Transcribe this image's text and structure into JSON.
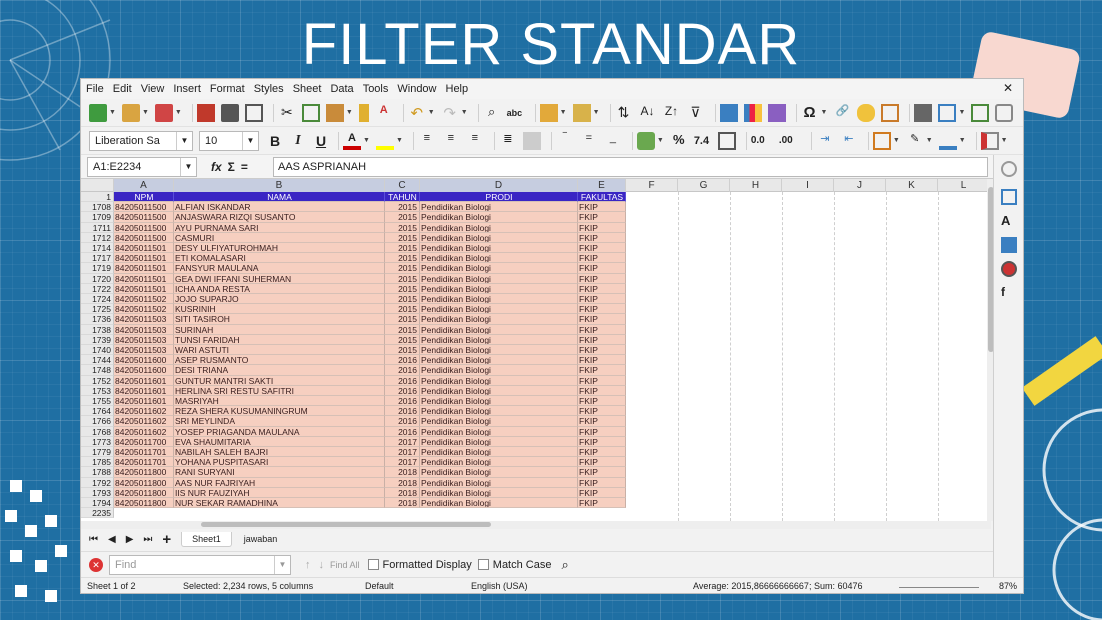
{
  "slide": {
    "title": "FILTER STANDAR"
  },
  "menu": [
    "File",
    "Edit",
    "View",
    "Insert",
    "Format",
    "Styles",
    "Sheet",
    "Data",
    "Tools",
    "Window",
    "Help"
  ],
  "toolbar": {
    "font_name": "Liberation Sa",
    "font_size": "10",
    "bold": "B",
    "italic": "I",
    "underline": "U",
    "percent": "%",
    "number_format": "7.4",
    "decimals_add": "0.0",
    "decimals_remove": ".00",
    "special_char": "Ω"
  },
  "formula_bar": {
    "name_box": "A1:E2234",
    "function_wizard": "fx",
    "sum": "Σ",
    "equals": "=",
    "content": "AAS ASPRIANAH"
  },
  "columns": [
    "A",
    "B",
    "C",
    "D",
    "E",
    "F",
    "G",
    "H",
    "I",
    "J",
    "K",
    "L"
  ],
  "header_row": {
    "row": "1",
    "cells": [
      "NPM",
      "NAMA",
      "TAHUN",
      "PRODI",
      "FAKULTAS"
    ]
  },
  "rows": [
    {
      "r": "1708",
      "npm": "84205011500",
      "nama": "ALFIAN ISKANDAR",
      "tahun": "2015",
      "prodi": "Pendidikan Biologi",
      "fak": "FKIP"
    },
    {
      "r": "1709",
      "npm": "84205011500",
      "nama": "ANJASWARA RIZQI SUSANTO",
      "tahun": "2015",
      "prodi": "Pendidikan Biologi",
      "fak": "FKIP"
    },
    {
      "r": "1711",
      "npm": "84205011500",
      "nama": "AYU PURNAMA SARI",
      "tahun": "2015",
      "prodi": "Pendidikan Biologi",
      "fak": "FKIP"
    },
    {
      "r": "1712",
      "npm": "84205011500",
      "nama": "CASMURI",
      "tahun": "2015",
      "prodi": "Pendidikan Biologi",
      "fak": "FKIP"
    },
    {
      "r": "1714",
      "npm": "84205011501",
      "nama": "DESY ULFIYATUROHMAH",
      "tahun": "2015",
      "prodi": "Pendidikan Biologi",
      "fak": "FKIP"
    },
    {
      "r": "1717",
      "npm": "84205011501",
      "nama": "ETI KOMALASARI",
      "tahun": "2015",
      "prodi": "Pendidikan Biologi",
      "fak": "FKIP"
    },
    {
      "r": "1719",
      "npm": "84205011501",
      "nama": "FANSYUR MAULANA",
      "tahun": "2015",
      "prodi": "Pendidikan Biologi",
      "fak": "FKIP"
    },
    {
      "r": "1720",
      "npm": "84205011501",
      "nama": "GEA DWI IFFANI SUHERMAN",
      "tahun": "2015",
      "prodi": "Pendidikan Biologi",
      "fak": "FKIP"
    },
    {
      "r": "1722",
      "npm": "84205011501",
      "nama": "ICHA ANDA RESTA",
      "tahun": "2015",
      "prodi": "Pendidikan Biologi",
      "fak": "FKIP"
    },
    {
      "r": "1724",
      "npm": "84205011502",
      "nama": "JOJO SUPARJO",
      "tahun": "2015",
      "prodi": "Pendidikan Biologi",
      "fak": "FKIP"
    },
    {
      "r": "1725",
      "npm": "84205011502",
      "nama": "KUSRINIH",
      "tahun": "2015",
      "prodi": "Pendidikan Biologi",
      "fak": "FKIP"
    },
    {
      "r": "1736",
      "npm": "84205011503",
      "nama": "SITI TASIROH",
      "tahun": "2015",
      "prodi": "Pendidikan Biologi",
      "fak": "FKIP"
    },
    {
      "r": "1738",
      "npm": "84205011503",
      "nama": "SURINAH",
      "tahun": "2015",
      "prodi": "Pendidikan Biologi",
      "fak": "FKIP"
    },
    {
      "r": "1739",
      "npm": "84205011503",
      "nama": "TUNSI FARIDAH",
      "tahun": "2015",
      "prodi": "Pendidikan Biologi",
      "fak": "FKIP"
    },
    {
      "r": "1740",
      "npm": "84205011503",
      "nama": "WARI ASTUTI",
      "tahun": "2015",
      "prodi": "Pendidikan Biologi",
      "fak": "FKIP"
    },
    {
      "r": "1744",
      "npm": "84205011600",
      "nama": "ASEP RUSMANTO",
      "tahun": "2016",
      "prodi": "Pendidikan Biologi",
      "fak": "FKIP"
    },
    {
      "r": "1748",
      "npm": "84205011600",
      "nama": "DESI TRIANA",
      "tahun": "2016",
      "prodi": "Pendidikan Biologi",
      "fak": "FKIP"
    },
    {
      "r": "1752",
      "npm": "84205011601",
      "nama": "GUNTUR MANTRI SAKTI",
      "tahun": "2016",
      "prodi": "Pendidikan Biologi",
      "fak": "FKIP"
    },
    {
      "r": "1753",
      "npm": "84205011601",
      "nama": "HERLINA SRI RESTU SAFITRI",
      "tahun": "2016",
      "prodi": "Pendidikan Biologi",
      "fak": "FKIP"
    },
    {
      "r": "1755",
      "npm": "84205011601",
      "nama": "MASRIYAH",
      "tahun": "2016",
      "prodi": "Pendidikan Biologi",
      "fak": "FKIP"
    },
    {
      "r": "1764",
      "npm": "84205011602",
      "nama": "REZA SHERA KUSUMANINGRUM",
      "tahun": "2016",
      "prodi": "Pendidikan Biologi",
      "fak": "FKIP"
    },
    {
      "r": "1766",
      "npm": "84205011602",
      "nama": "SRI MEYLINDA",
      "tahun": "2016",
      "prodi": "Pendidikan Biologi",
      "fak": "FKIP"
    },
    {
      "r": "1768",
      "npm": "84205011602",
      "nama": "YOSEP PRIAGANDA MAULANA",
      "tahun": "2016",
      "prodi": "Pendidikan Biologi",
      "fak": "FKIP"
    },
    {
      "r": "1773",
      "npm": "84205011700",
      "nama": "EVA SHAUMITARIA",
      "tahun": "2017",
      "prodi": "Pendidikan Biologi",
      "fak": "FKIP"
    },
    {
      "r": "1779",
      "npm": "84205011701",
      "nama": "NABILAH SALEH BAJRI",
      "tahun": "2017",
      "prodi": "Pendidikan Biologi",
      "fak": "FKIP"
    },
    {
      "r": "1785",
      "npm": "84205011701",
      "nama": "YOHANA PUSPITASARI",
      "tahun": "2017",
      "prodi": "Pendidikan Biologi",
      "fak": "FKIP"
    },
    {
      "r": "1788",
      "npm": "84205011800",
      "nama": "RANI SURYANI",
      "tahun": "2018",
      "prodi": "Pendidikan Biologi",
      "fak": "FKIP"
    },
    {
      "r": "1792",
      "npm": "84205011800",
      "nama": "AAS NUR FAJRIYAH",
      "tahun": "2018",
      "prodi": "Pendidikan Biologi",
      "fak": "FKIP"
    },
    {
      "r": "1793",
      "npm": "84205011800",
      "nama": "IIS NUR FAUZIYAH",
      "tahun": "2018",
      "prodi": "Pendidikan Biologi",
      "fak": "FKIP"
    },
    {
      "r": "1794",
      "npm": "84205011800",
      "nama": "NUR SEKAR RAMADHINA",
      "tahun": "2018",
      "prodi": "Pendidikan Biologi",
      "fak": "FKIP"
    }
  ],
  "last_row": "2235",
  "tabs": [
    {
      "label": "Sheet1",
      "active": true
    },
    {
      "label": "jawaban",
      "active": false
    }
  ],
  "find": {
    "placeholder": "Find",
    "find_all": "Find All",
    "formatted_display": "Formatted Display",
    "match_case": "Match Case"
  },
  "status": {
    "sheet": "Sheet 1 of 2",
    "selected": "Selected: 2,234 rows, 5 columns",
    "style": "Default",
    "language": "English (USA)",
    "stats": "Average: 2015,86666666667; Sum: 60476",
    "zoom": "87%"
  },
  "colors": {
    "header_fill": "#3a25c4",
    "selection_fill": "#f6cfc0",
    "slide_bg": "#1f6fa3"
  }
}
